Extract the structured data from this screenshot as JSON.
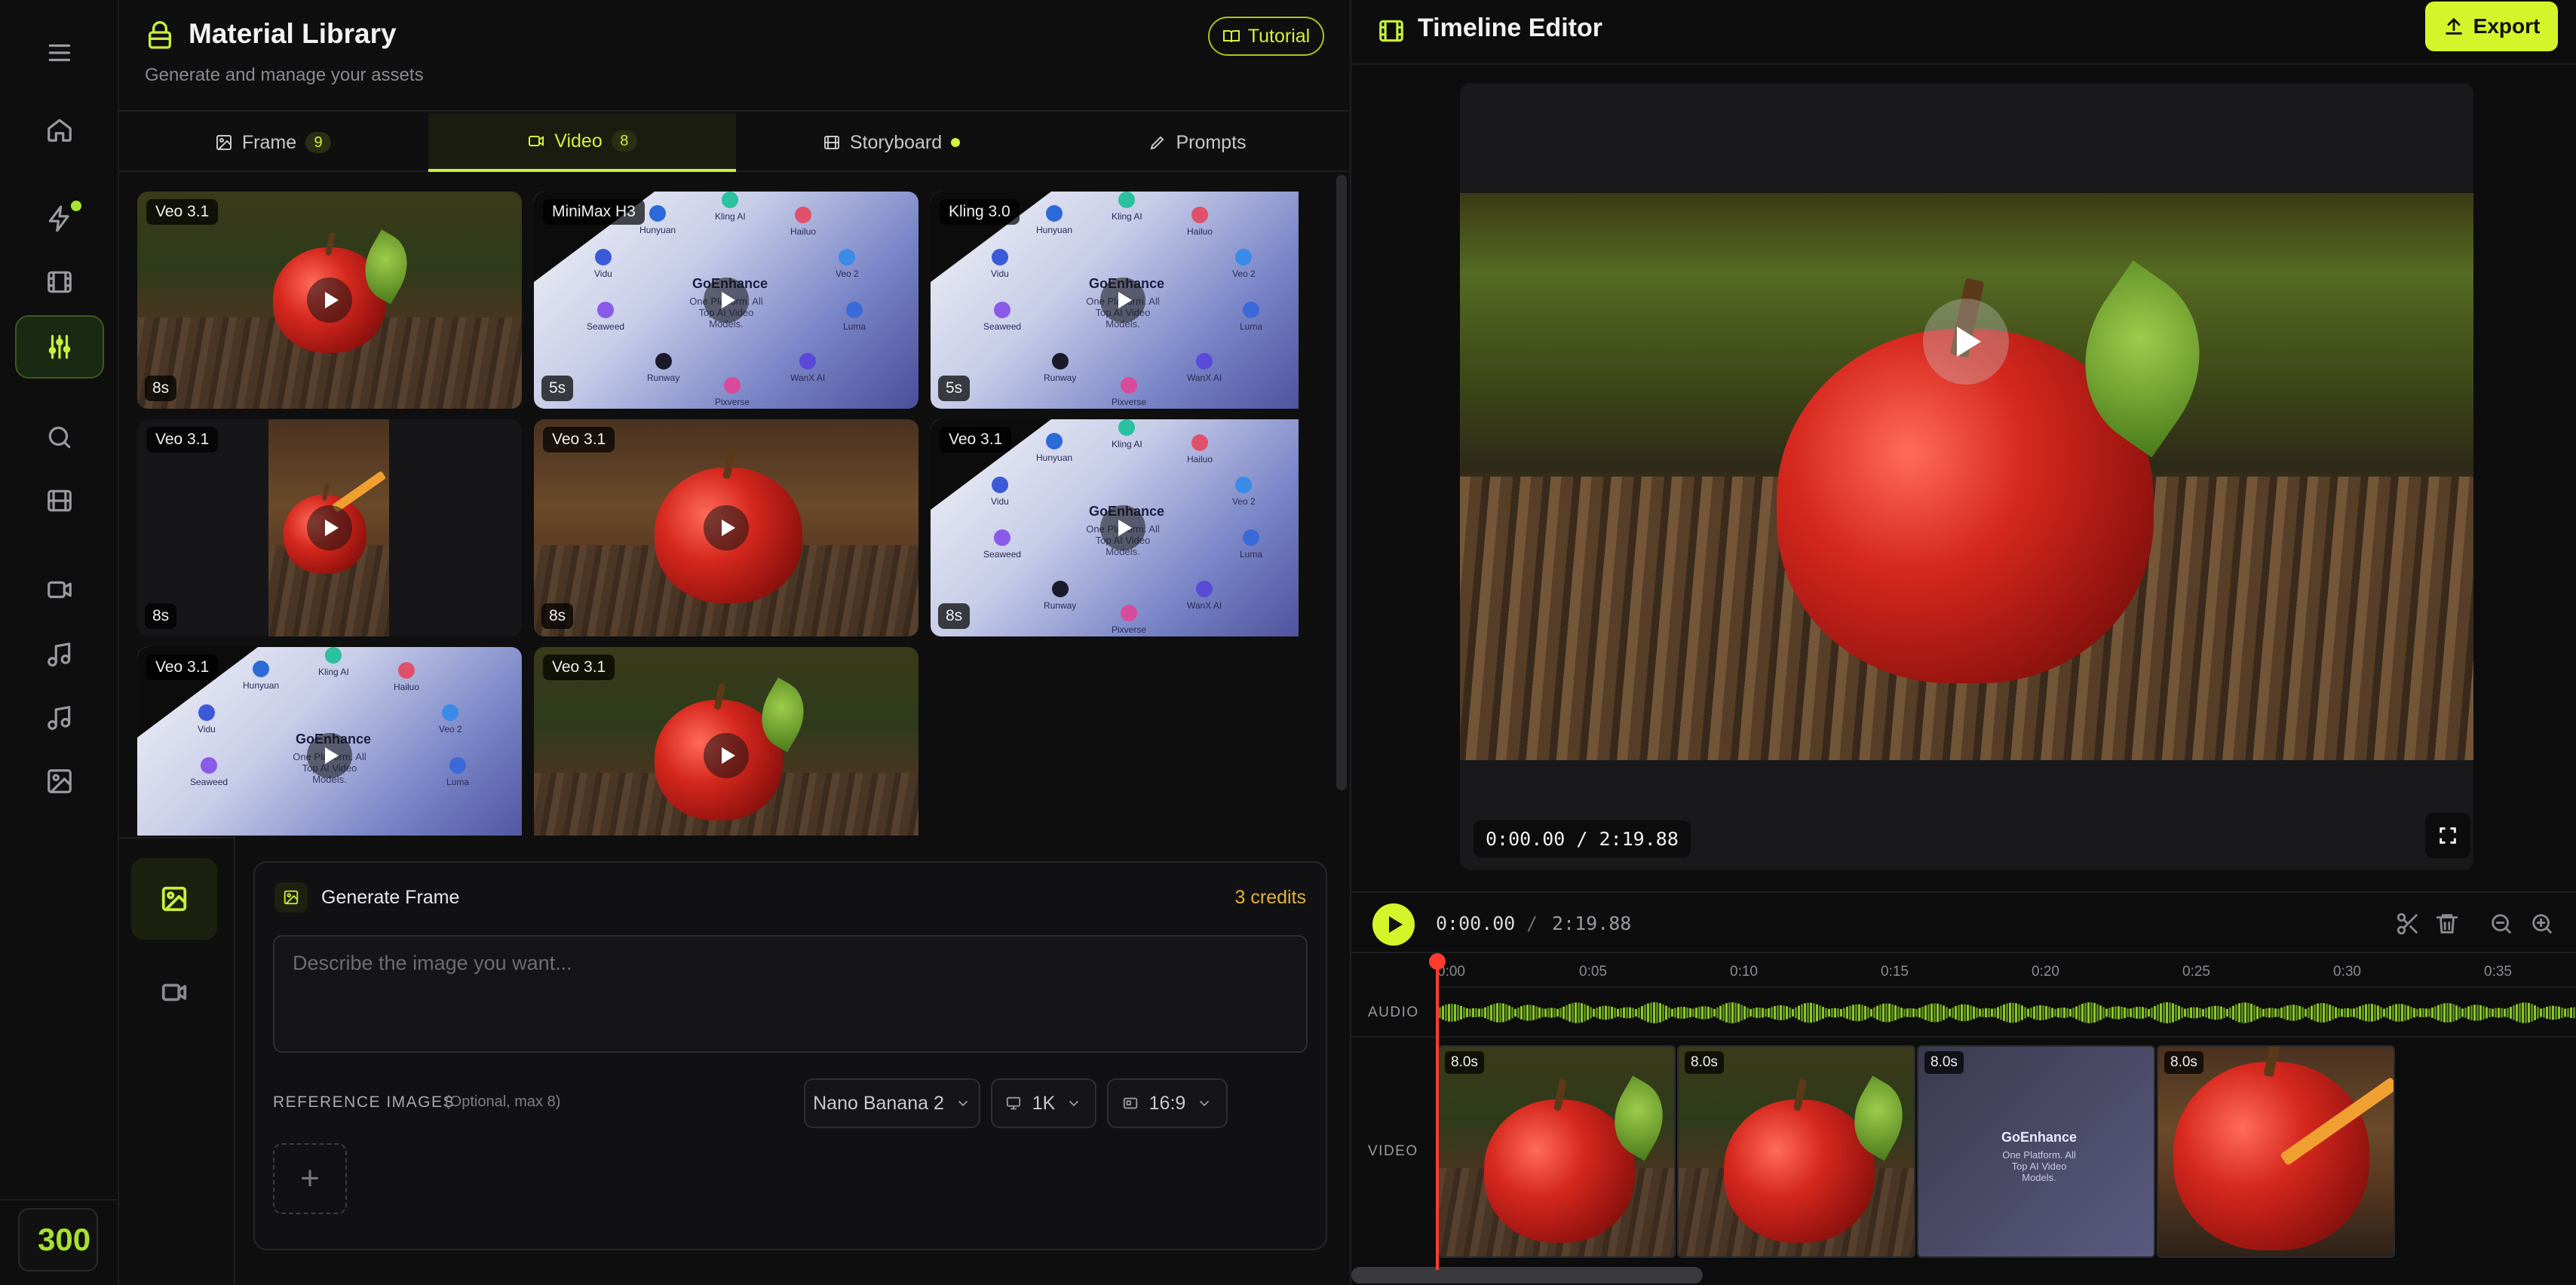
{
  "rail": {
    "credits": "300",
    "items": [
      "home",
      "quick-generate",
      "films",
      "adjustments",
      "search",
      "storyboard",
      "video",
      "music",
      "music-alt",
      "image"
    ]
  },
  "library": {
    "title": "Material Library",
    "subtitle": "Generate and manage your assets",
    "tutorial_label": "Tutorial",
    "tabs": [
      {
        "label": "Frame",
        "count": "9"
      },
      {
        "label": "Video",
        "count": "8"
      },
      {
        "label": "Storyboard",
        "count": ""
      },
      {
        "label": "Prompts",
        "count": ""
      }
    ],
    "videos": [
      {
        "model": "Veo 3.1",
        "duration": "8s",
        "kind": "apple"
      },
      {
        "model": "MiniMax H3",
        "duration": "5s",
        "kind": "promo"
      },
      {
        "model": "Kling 3.0",
        "duration": "5s",
        "kind": "promo"
      },
      {
        "model": "Veo 3.1",
        "duration": "8s",
        "kind": "apple-pencil"
      },
      {
        "model": "Veo 3.1",
        "duration": "8s",
        "kind": "apple-warm"
      },
      {
        "model": "Veo 3.1",
        "duration": "8s",
        "kind": "promo"
      },
      {
        "model": "Veo 3.1",
        "duration": "",
        "kind": "promo"
      },
      {
        "model": "Veo 3.1",
        "duration": "",
        "kind": "apple"
      }
    ],
    "promo": {
      "brand": "GoEnhance",
      "tagline": "One Platform. All Top AI Video Models.",
      "models": [
        "Hunyuan",
        "Kling AI",
        "Hailuo",
        "Vidu",
        "Veo 2",
        "Seaweed",
        "Luma",
        "Runway",
        "WanX AI",
        "Pixverse"
      ]
    }
  },
  "generate": {
    "title": "Generate Frame",
    "credits": "3 credits",
    "prompt_placeholder": "Describe the image you want...",
    "ref_label": "REFERENCE IMAGES",
    "ref_hint": "(Optional, max 8)",
    "model": "Nano Banana 2",
    "resolution": "1K",
    "aspect": "16:9",
    "add_symbol": "+"
  },
  "timeline": {
    "title": "Timeline Editor",
    "export_label": "Export",
    "preview_time": "0:00.00 / 2:19.88",
    "current_time": "0:00.00",
    "separator": "/",
    "total_time": "2:19.88",
    "ruler": [
      "0:00",
      "0:05",
      "0:10",
      "0:15",
      "0:20",
      "0:25",
      "0:30",
      "0:35"
    ],
    "audio_label": "AUDIO",
    "video_label": "VIDEO",
    "clips": [
      {
        "duration": "8.0s",
        "kind": "apple"
      },
      {
        "duration": "8.0s",
        "kind": "apple"
      },
      {
        "duration": "8.0s",
        "kind": "promo"
      },
      {
        "duration": "8.0s",
        "kind": "apple-pencil"
      }
    ]
  },
  "colors": {
    "accent": "#d4f52a",
    "playhead": "#ff3b30",
    "credits_text": "#e3b23c"
  }
}
